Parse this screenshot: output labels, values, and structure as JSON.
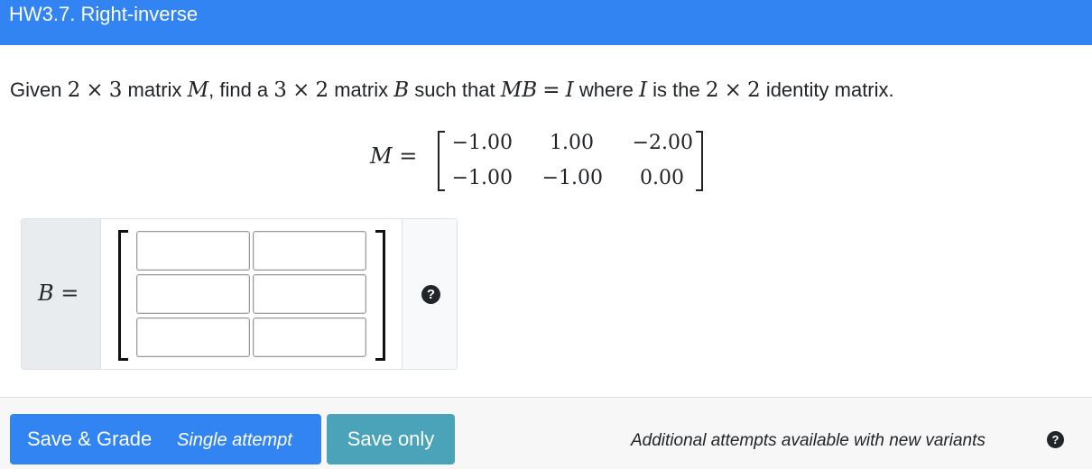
{
  "header": {
    "title": "HW3.7. Right-inverse"
  },
  "question": {
    "intro_given": "Given",
    "dim1_rows": "2",
    "dim_times": "×",
    "dim1_cols": "3",
    "text_matrix": "matrix",
    "var_M": "M",
    "text_comma_find": ", find a",
    "dim2_rows": "3",
    "dim2_cols": "2",
    "var_B": "B",
    "text_such_that": "such that",
    "var_MB": "MB",
    "equals": "=",
    "var_I": "I",
    "text_where": "where",
    "text_is_the": "is the",
    "dim3_rows": "2",
    "dim3_cols": "2",
    "text_identity": "identity matrix."
  },
  "matrix_M": {
    "label_var": "M",
    "label_eq": "=",
    "rows": [
      [
        "−1.00",
        "1.00",
        "−2.00"
      ],
      [
        "−1.00",
        "−1.00",
        "0.00"
      ]
    ]
  },
  "answer": {
    "label_var": "B",
    "label_eq": "=",
    "cells": [
      [
        "",
        ""
      ],
      [
        "",
        ""
      ],
      [
        "",
        ""
      ]
    ],
    "help_icon": "question-circle-icon",
    "help_glyph": "?"
  },
  "footer": {
    "save_grade_label": "Save & Grade",
    "save_grade_sub": "Single attempt",
    "save_only_label": "Save only",
    "attempts_text": "Additional attempts available with new variants",
    "attempts_help_glyph": "?"
  },
  "colors": {
    "header_bg": "#3184f2",
    "primary": "#3184f2",
    "info": "#4aa3b8"
  }
}
